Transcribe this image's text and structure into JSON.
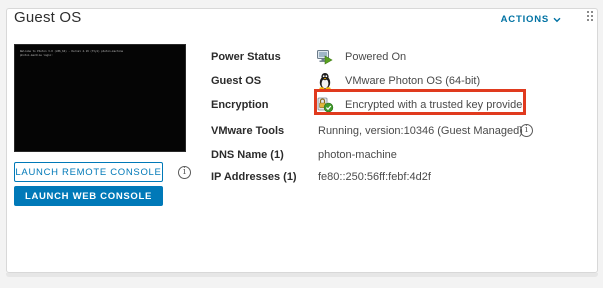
{
  "card": {
    "title": "Guest OS",
    "actions_label": "ACTIONS",
    "actions_icon": "chevron-down-icon",
    "drag_icon": "grip-dots-icon"
  },
  "console": {
    "lines": [
      "Welcome to Photon 3.0 (x86_64) - Kernel 4.19 (tty1) photon-machine",
      "photon-machine login:"
    ],
    "launch_remote_label": "LAUNCH REMOTE CONSOLE",
    "launch_web_label": "LAUNCH WEB CONSOLE",
    "info_icon": "info-icon"
  },
  "properties": [
    {
      "label": "Power Status",
      "value": "Powered On",
      "icon": "power-on-icon"
    },
    {
      "label": "Guest OS",
      "value": "VMware Photon OS (64-bit)",
      "icon": "linux-tux-icon"
    },
    {
      "label": "Encryption",
      "value": "Encrypted with a trusted key provider",
      "icon": "encryption-lock-icon"
    },
    {
      "label": "VMware Tools",
      "value": "Running, version:10346 (Guest Managed)",
      "icon": "info-icon"
    },
    {
      "label": "DNS Name (1)",
      "value": "photon-machine"
    },
    {
      "label": "IP Addresses (1)",
      "value": "fe80::250:56ff:febf:4d2f"
    }
  ],
  "colors": {
    "accent": "#0079b8",
    "highlight": "#e03a1e",
    "power_green": "#5aa220"
  }
}
